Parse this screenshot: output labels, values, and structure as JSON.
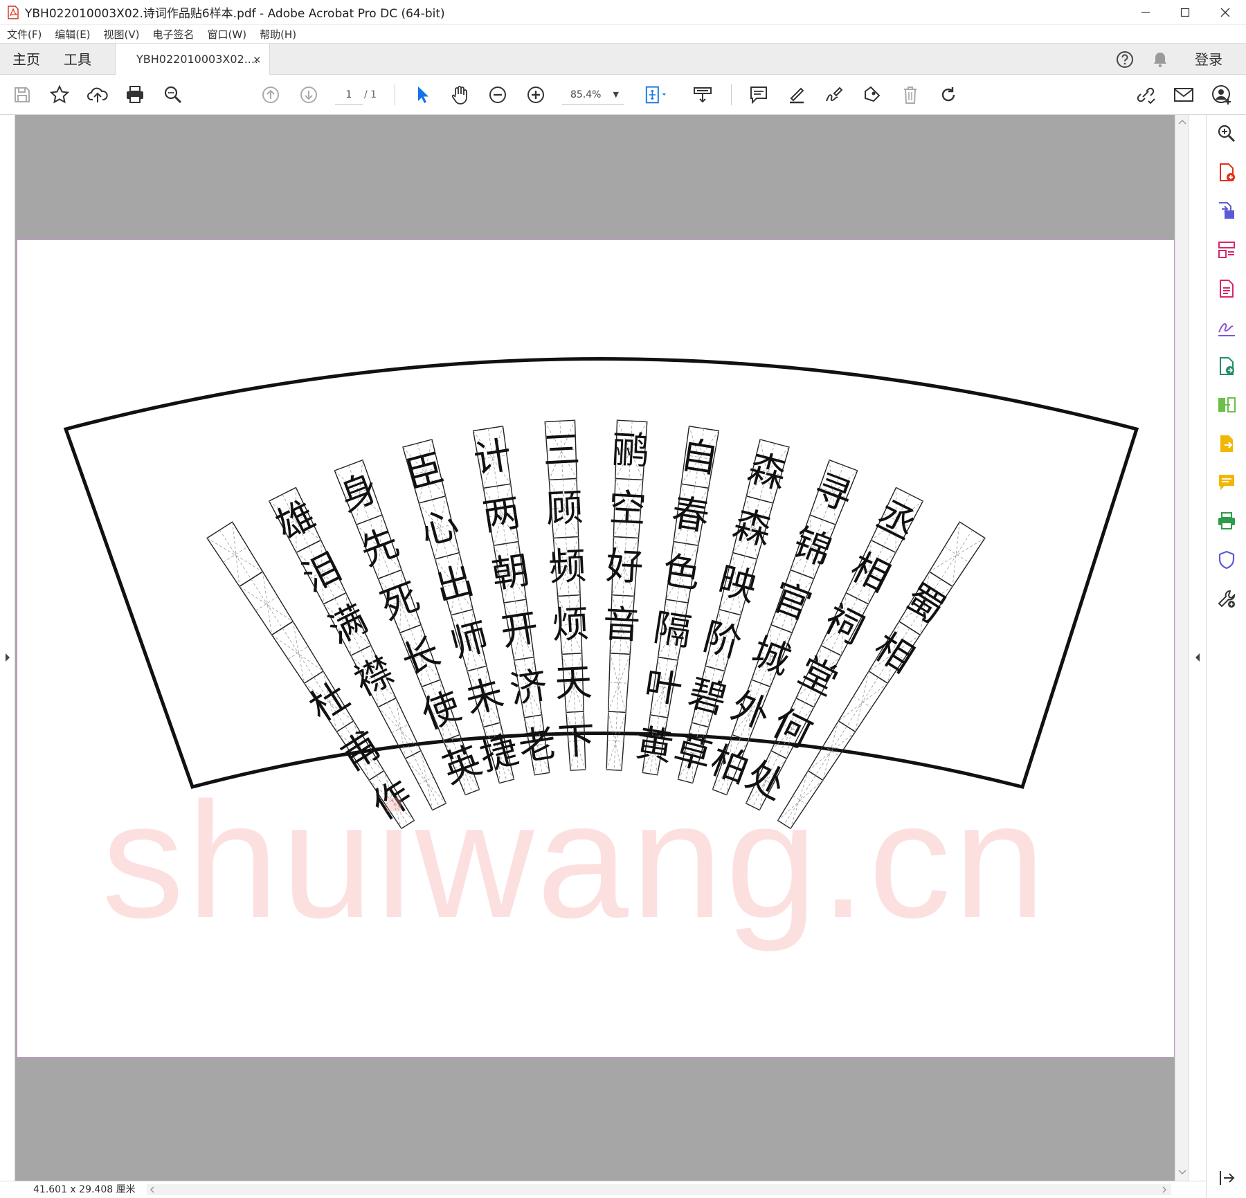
{
  "window": {
    "title": "YBH022010003X02.诗词作品贴6样本.pdf - Adobe Acrobat Pro DC (64-bit)",
    "minimize_glyph": "—",
    "maximize_glyph": "☐",
    "close_glyph": "✕"
  },
  "menu": [
    "文件(F)",
    "编辑(E)",
    "视图(V)",
    "电子签名",
    "窗口(W)",
    "帮助(H)"
  ],
  "tabs": {
    "home": "主页",
    "tools": "工具",
    "document": "YBH022010003X02....",
    "close_glyph": "×",
    "login": "登录"
  },
  "toolbar": {
    "page_current": "1",
    "page_total": "/ 1",
    "zoom": "85.4%",
    "zoom_caret": "▼"
  },
  "document": {
    "watermark": "shuiwang.cn",
    "fan": {
      "columns_left_to_right": [
        [
          "",
          "",
          "",
          "杜",
          "甫",
          "作"
        ],
        [
          "雄",
          "泪",
          "满",
          "襟",
          "",
          ""
        ],
        [
          "身",
          "先",
          "死",
          "长",
          "使",
          "英"
        ],
        [
          "臣",
          "心",
          "出",
          "师",
          "未",
          "捷"
        ],
        [
          "计",
          "两",
          "朝",
          "开",
          "济",
          "老"
        ],
        [
          "三",
          "顾",
          "频",
          "烦",
          "天",
          "下"
        ],
        [
          "鹂",
          "空",
          "好",
          "音",
          "",
          ""
        ],
        [
          "自",
          "春",
          "色",
          "隔",
          "叶",
          "黄"
        ],
        [
          "森",
          "森",
          "映",
          "阶",
          "碧",
          "草"
        ],
        [
          "寻",
          "锦",
          "官",
          "城",
          "外",
          "柏"
        ],
        [
          "丞",
          "相",
          "祠",
          "堂",
          "何",
          "处"
        ],
        [
          "",
          "蜀",
          "相",
          "",
          "",
          ""
        ]
      ]
    }
  },
  "status": {
    "page_size": "41.601 x 29.408 厘米"
  },
  "colors": {
    "accent_blue": "#1473e6",
    "acrobat_red": "#e3301b",
    "viewer_gray": "#a6a6a6"
  },
  "icons": {
    "toolbar": [
      "save-icon",
      "bookmark-star-icon",
      "upload-cloud-icon",
      "print-icon",
      "find-zoom-icon",
      "page-up-icon",
      "page-down-icon",
      "select-arrow-icon",
      "hand-icon",
      "zoom-out-icon",
      "zoom-in-icon",
      "fit-page-icon",
      "read-mode-icon",
      "comment-icon",
      "highlight-icon",
      "sign-icon",
      "stamp-icon",
      "delete-icon",
      "rotate-icon",
      "share-link-icon",
      "email-icon",
      "account-icon"
    ],
    "right_panel": [
      "zoom-search-icon",
      "create-pdf-icon",
      "export-pdf-icon",
      "organize-pages-icon",
      "edit-pdf-icon",
      "fill-sign-icon",
      "send-review-icon",
      "combine-files-icon",
      "export-file-icon",
      "comment-panel-icon",
      "print-production-icon",
      "protect-icon",
      "more-tools-icon",
      "collapse-panel-icon"
    ]
  }
}
